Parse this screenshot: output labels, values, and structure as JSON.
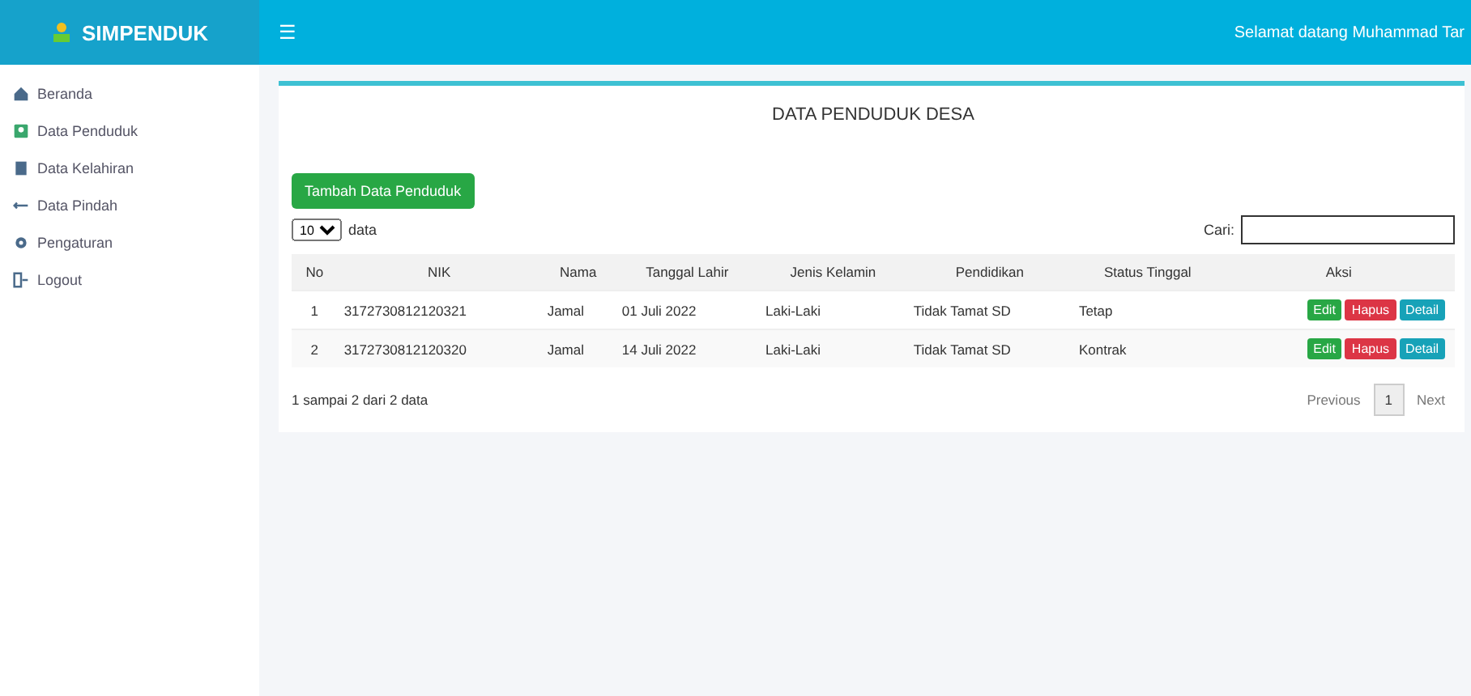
{
  "header": {
    "brand": "SIMPENDUK",
    "menu_toggle": "☰",
    "greeting": "Selamat datang Muhammad Tar"
  },
  "sidebar": {
    "items": [
      {
        "label": "Beranda",
        "kind": "home"
      },
      {
        "label": "Data Penduduk",
        "kind": "user"
      },
      {
        "label": "Data Kelahiran",
        "kind": "baby"
      },
      {
        "label": "Data Pindah",
        "kind": "move"
      },
      {
        "label": "Pengaturan",
        "kind": "gear"
      },
      {
        "label": "Logout",
        "kind": "logout"
      }
    ]
  },
  "card": {
    "title": "DATA PENDUDUK DESA",
    "add_button": "Tambah Data Penduduk",
    "length_value": "10",
    "length_label": "data",
    "search_label": "Cari:",
    "table": {
      "columns": [
        "No",
        "NIK",
        "Nama",
        "Tanggal Lahir",
        "Jenis Kelamin",
        "Pendidikan",
        "Status Tinggal",
        "Aksi"
      ],
      "rows": [
        {
          "cells": [
            "1",
            "3172730812120321",
            "Jamal",
            "01 Juli 2022",
            "Laki-Laki",
            "Tidak Tamat SD",
            "Tetap"
          ],
          "actions": [
            {
              "label": "Edit",
              "kind": "edit"
            },
            {
              "label": "Hapus",
              "kind": "delete"
            },
            {
              "label": "Detail",
              "kind": "detail"
            }
          ]
        },
        {
          "cells": [
            "2",
            "3172730812120320",
            "Jamal",
            "14 Juli 2022",
            "Laki-Laki",
            "Tidak Tamat SD",
            "Kontrak"
          ],
          "actions": [
            {
              "label": "Edit",
              "kind": "edit"
            },
            {
              "label": "Hapus",
              "kind": "delete"
            },
            {
              "label": "Detail",
              "kind": "detail"
            }
          ]
        }
      ]
    },
    "info": "1 sampai 2 dari 2 data",
    "pagination": [
      {
        "label": "Previous",
        "selected": false
      },
      {
        "label": "1",
        "selected": true
      },
      {
        "label": "Next",
        "selected": false
      }
    ]
  }
}
